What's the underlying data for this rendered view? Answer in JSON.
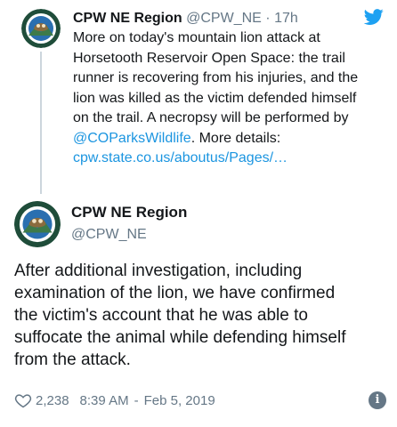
{
  "parent_tweet": {
    "name": "CPW NE Region",
    "handle": "@CPW_NE",
    "separator": "·",
    "time": "17h",
    "text_lines": [
      "More on today's mountain lion attack at",
      "Horsetooth Reservoir Open Space: the trail",
      "runner is recovering from his injuries, and the",
      "lion was killed as the victim defended himself",
      "on the trail. A necropsy will be performed by"
    ],
    "mention": "@COParksWildlife",
    "after_mention": ". More details:",
    "link": "cpw.state.co.us/aboutus/Pages/…",
    "avatar_icon": "colorado-parks-wildlife-logo",
    "brand_icon": "twitter-bird-icon"
  },
  "main_tweet": {
    "name": "CPW NE Region",
    "handle": "@CPW_NE",
    "text_lines": [
      "After additional investigation, including",
      "examination of the lion, we have confirmed",
      "the victim's account that he was able to",
      "suffocate the animal while defending himself",
      "from the attack."
    ],
    "avatar_icon": "colorado-parks-wildlife-logo",
    "likes": "2,238",
    "time": "8:39 AM",
    "separator": "-",
    "date": "Feb 5, 2019",
    "info_glyph": "i"
  },
  "colors": {
    "text": "#14171a",
    "muted": "#657786",
    "link": "#1b95e0",
    "thread_line": "#ccd6dd",
    "twitter_blue": "#1da1f2",
    "avatar_green": "#1f4d3a"
  }
}
